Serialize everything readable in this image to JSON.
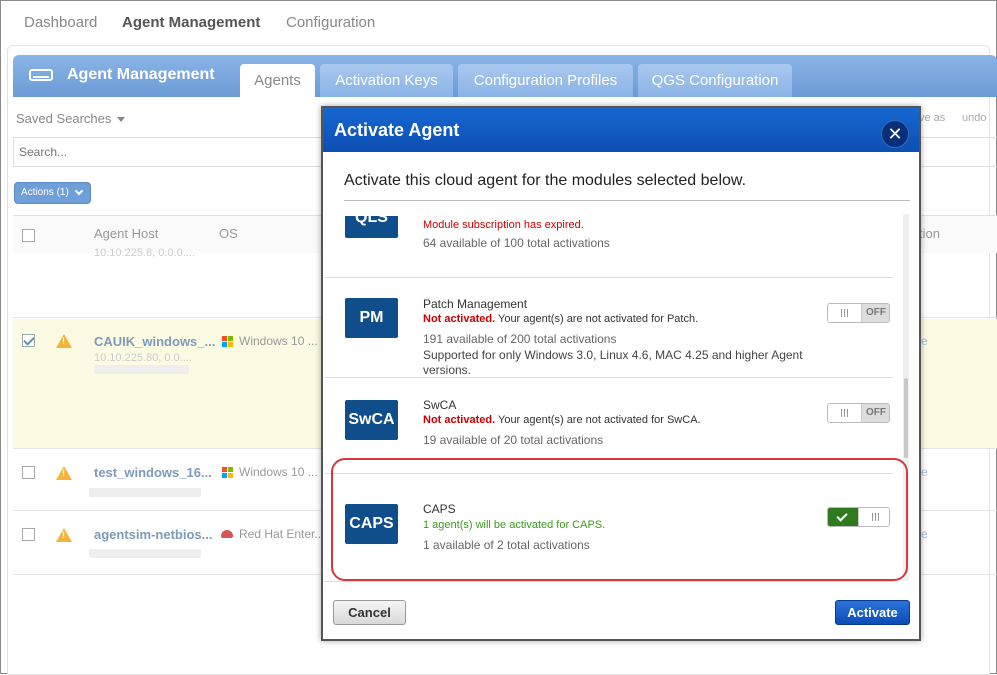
{
  "nav": {
    "items": [
      {
        "label": "Dashboard",
        "active": false
      },
      {
        "label": "Agent Management",
        "active": true
      },
      {
        "label": "Configuration",
        "active": false
      }
    ]
  },
  "module_header": {
    "title": "Agent Management",
    "tabs": [
      "Agents",
      "Activation Keys",
      "Configuration Profiles",
      "QGS Configuration"
    ],
    "active_tab": "Agents"
  },
  "toolbar": {
    "saved_searches": "Saved Searches",
    "right_tools_partial": "ve as",
    "undo": "undo",
    "search_placeholder": "Search...",
    "actions_label": "Actions (1)"
  },
  "table": {
    "headers": {
      "host": "Agent Host",
      "os": "OS",
      "right_partial": "tion"
    },
    "rows": [
      {
        "host": "",
        "ip": "10.10.225.8, 0.0.0....",
        "os": "",
        "checked": false
      },
      {
        "host": "CAUIK_windows_...",
        "ip": "10.10.225.80, 0.0....",
        "os": "Windows 10 ...",
        "checked": true,
        "edge": "e"
      },
      {
        "host": "test_windows_16...",
        "ip": "",
        "os": "Windows 10 ...",
        "checked": false,
        "edge": "e"
      },
      {
        "host": "agentsim-netbios...",
        "ip": "",
        "os": "Red Hat Enter...",
        "checked": false,
        "edge": "e"
      }
    ]
  },
  "modal": {
    "title": "Activate Agent",
    "subtitle": "Activate this cloud agent for the modules selected below.",
    "modules": [
      {
        "code": "QLS",
        "status_red": "Module subscription has expired.",
        "availability": "64 available of 100 total activations"
      },
      {
        "code": "PM",
        "name": "Patch Management",
        "status_red": "Not activated.",
        "status_rest": " Your agent(s) are not activated for Patch.",
        "availability": "191 available of 200 total activations",
        "note": "Supported for only Windows 3.0, Linux 4.6, MAC 4.25 and higher Agent versions.",
        "toggle": "OFF"
      },
      {
        "code": "SwCA",
        "name": "SwCA",
        "status_red": "Not activated.",
        "status_rest": " Your agent(s) are not activated for SwCA.",
        "availability": "19 available of 20 total activations",
        "toggle": "OFF"
      },
      {
        "code": "CAPS",
        "name": "CAPS",
        "status_green": "1 agent(s) will be activated for CAPS.",
        "availability": "1 available of 2 total activations",
        "toggle": "ON"
      }
    ],
    "cancel_label": "Cancel",
    "activate_label": "Activate"
  },
  "colors": {
    "modal_title_bg": "#0c4fb2",
    "badge_bg": "#0f4e8a",
    "not_activated": "#cc0000",
    "will_activate": "#3a9a1e",
    "toggle_on": "#2f7a1f",
    "highlight_ring": "#d9363e"
  }
}
